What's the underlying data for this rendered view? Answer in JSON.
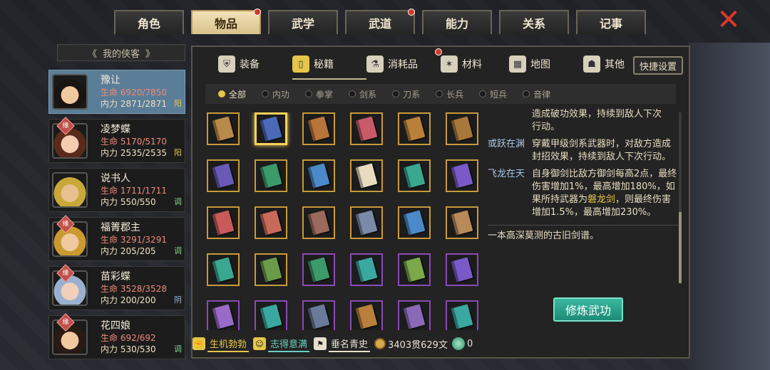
{
  "top_tabs": [
    {
      "label": "角色",
      "active": false,
      "dot": false
    },
    {
      "label": "物品",
      "active": true,
      "dot": true
    },
    {
      "label": "武学",
      "active": false,
      "dot": false
    },
    {
      "label": "武道",
      "active": false,
      "dot": true
    },
    {
      "label": "能力",
      "active": false,
      "dot": false
    },
    {
      "label": "关系",
      "active": false,
      "dot": false
    },
    {
      "label": "记事",
      "active": false,
      "dot": false
    }
  ],
  "close_icon": "✕",
  "hero_list_title": "我的侠客",
  "heroes": [
    {
      "name": "豫让",
      "hp_label": "生命",
      "hp": "6920/7850",
      "mp_label": "内力",
      "mp": "2871/2871",
      "tag": "阳",
      "tag_type": "yang",
      "fate": false,
      "active": true,
      "skin": "#f1c9a0",
      "hair": "#1a1410"
    },
    {
      "name": "凌梦蝶",
      "hp_label": "生命",
      "hp": "5170/5170",
      "mp_label": "内力",
      "mp": "2535/2535",
      "tag": "阳",
      "tag_type": "yang",
      "fate": true,
      "active": false,
      "skin": "#f4cdb0",
      "hair": "#5a2a1a"
    },
    {
      "name": "说书人",
      "hp_label": "生命",
      "hp": "1711/1711",
      "mp_label": "内力",
      "mp": "550/550",
      "tag": "调",
      "tag_type": "tiao",
      "fate": false,
      "active": false,
      "skin": "#e8c090",
      "hair": "#c8a838"
    },
    {
      "name": "福箐郡主",
      "hp_label": "生命",
      "hp": "3291/3291",
      "mp_label": "内力",
      "mp": "205/205",
      "tag": "调",
      "tag_type": "tiao",
      "fate": true,
      "active": false,
      "skin": "#f1c9a0",
      "hair": "#c89a30"
    },
    {
      "name": "苗彩蝶",
      "hp_label": "生命",
      "hp": "3528/3528",
      "mp_label": "内力",
      "mp": "200/200",
      "tag": "阴",
      "tag_type": "yin",
      "fate": true,
      "active": false,
      "skin": "#f0d0b8",
      "hair": "#9ab0d0"
    },
    {
      "name": "花四娘",
      "hp_label": "生命",
      "hp": "692/692",
      "mp_label": "内力",
      "mp": "530/530",
      "tag": "调",
      "tag_type": "tiao",
      "fate": true,
      "active": false,
      "skin": "#f1c9a0",
      "hair": "#2a1a14"
    }
  ],
  "fate_label": "缘",
  "categories": [
    {
      "label": "装备",
      "icon": "armor-icon",
      "glyph": "⛨",
      "active": false,
      "dot": false
    },
    {
      "label": "秘籍",
      "icon": "manual-icon",
      "glyph": "▯",
      "active": true,
      "dot": false
    },
    {
      "label": "消耗品",
      "icon": "potion-icon",
      "glyph": "⚗",
      "active": false,
      "dot": true
    },
    {
      "label": "材料",
      "icon": "herb-icon",
      "glyph": "✶",
      "active": false,
      "dot": false
    },
    {
      "label": "地图",
      "icon": "map-icon",
      "glyph": "▦",
      "active": false,
      "dot": false
    },
    {
      "label": "其他",
      "icon": "lamp-icon",
      "glyph": "☗",
      "active": false,
      "dot": false
    }
  ],
  "quick_settings": "快捷设置",
  "filters": [
    {
      "label": "全部",
      "active": true
    },
    {
      "label": "内功",
      "active": false
    },
    {
      "label": "拳掌",
      "active": false
    },
    {
      "label": "剑系",
      "active": false
    },
    {
      "label": "刀系",
      "active": false
    },
    {
      "label": "长兵",
      "active": false
    },
    {
      "label": "短兵",
      "active": false
    },
    {
      "label": "音律",
      "active": false
    }
  ],
  "books": [
    {
      "color": "#b88a4a",
      "frame": "gold",
      "selected": false
    },
    {
      "color": "#4a6ab8",
      "frame": "gold",
      "selected": true
    },
    {
      "color": "#b8743a",
      "frame": "gold",
      "selected": false
    },
    {
      "color": "#c85a6a",
      "frame": "gold",
      "selected": false
    },
    {
      "color": "#b8803a",
      "frame": "gold",
      "selected": false
    },
    {
      "color": "#a8783a",
      "frame": "gold",
      "selected": false
    },
    {
      "color": "#6a5ab8",
      "frame": "gold",
      "selected": false
    },
    {
      "color": "#3a9a6a",
      "frame": "gold",
      "selected": false
    },
    {
      "color": "#4a8ac8",
      "frame": "gold",
      "selected": false
    },
    {
      "color": "#e8dcc0",
      "frame": "gold",
      "selected": false
    },
    {
      "color": "#3aa890",
      "frame": "gold",
      "selected": false
    },
    {
      "color": "#7a5ac8",
      "frame": "gold",
      "selected": false
    },
    {
      "color": "#c85a5a",
      "frame": "gold",
      "selected": false
    },
    {
      "color": "#c86a5a",
      "frame": "gold",
      "selected": false
    },
    {
      "color": "#9a6a5a",
      "frame": "gold",
      "selected": false
    },
    {
      "color": "#7a8aa8",
      "frame": "gold",
      "selected": false
    },
    {
      "color": "#4a8ac8",
      "frame": "gold",
      "selected": false
    },
    {
      "color": "#b88a5a",
      "frame": "gold",
      "selected": false
    },
    {
      "color": "#3aa890",
      "frame": "gold",
      "selected": false
    },
    {
      "color": "#6a9a4a",
      "frame": "gold",
      "selected": false
    },
    {
      "color": "#3a9a6a",
      "frame": "purple",
      "selected": false
    },
    {
      "color": "#3aa8a0",
      "frame": "purple",
      "selected": false
    },
    {
      "color": "#7aa84a",
      "frame": "purple",
      "selected": false
    },
    {
      "color": "#7a5ac8",
      "frame": "purple",
      "selected": false
    },
    {
      "color": "#9a6ac8",
      "frame": "purple",
      "selected": false
    },
    {
      "color": "#3aa8a0",
      "frame": "purple",
      "selected": false
    },
    {
      "color": "#6a7a9a",
      "frame": "purple",
      "selected": false
    },
    {
      "color": "#b8803a",
      "frame": "purple",
      "selected": false
    },
    {
      "color": "#8a6ab8",
      "frame": "purple",
      "selected": false
    },
    {
      "color": "#3aa8a0",
      "frame": "purple",
      "selected": false
    }
  ],
  "detail": {
    "intro_line1": "造成破功效果，持续到敌人下次",
    "intro_line2": "行动。",
    "skills": [
      {
        "name": "或跃在渊",
        "text_parts": [
          "穿戴甲级剑系武器时，对敌方造成封招效果，持续到敌人下次行动。"
        ]
      },
      {
        "name": "飞龙在天",
        "text_before": "自身御剑比敌方御剑每高2点，最终伤害增加1%，最高增加180%，如果所持武器为",
        "highlight": "磐龙剑",
        "text_after": "，则最终伤害增加1.5%，最高增加230%。"
      }
    ],
    "description": "一本高深莫测的古旧剑谱。"
  },
  "practice_button": "修炼武功",
  "bottom_bar": {
    "mood1_icon": "strength-icon",
    "mood1": "生机勃勃",
    "mood2_icon": "face-icon",
    "mood2": "志得意满",
    "fame_icon": "flag-icon",
    "fame": "垂名青史",
    "money": "3403贯629文",
    "gems": "0"
  }
}
